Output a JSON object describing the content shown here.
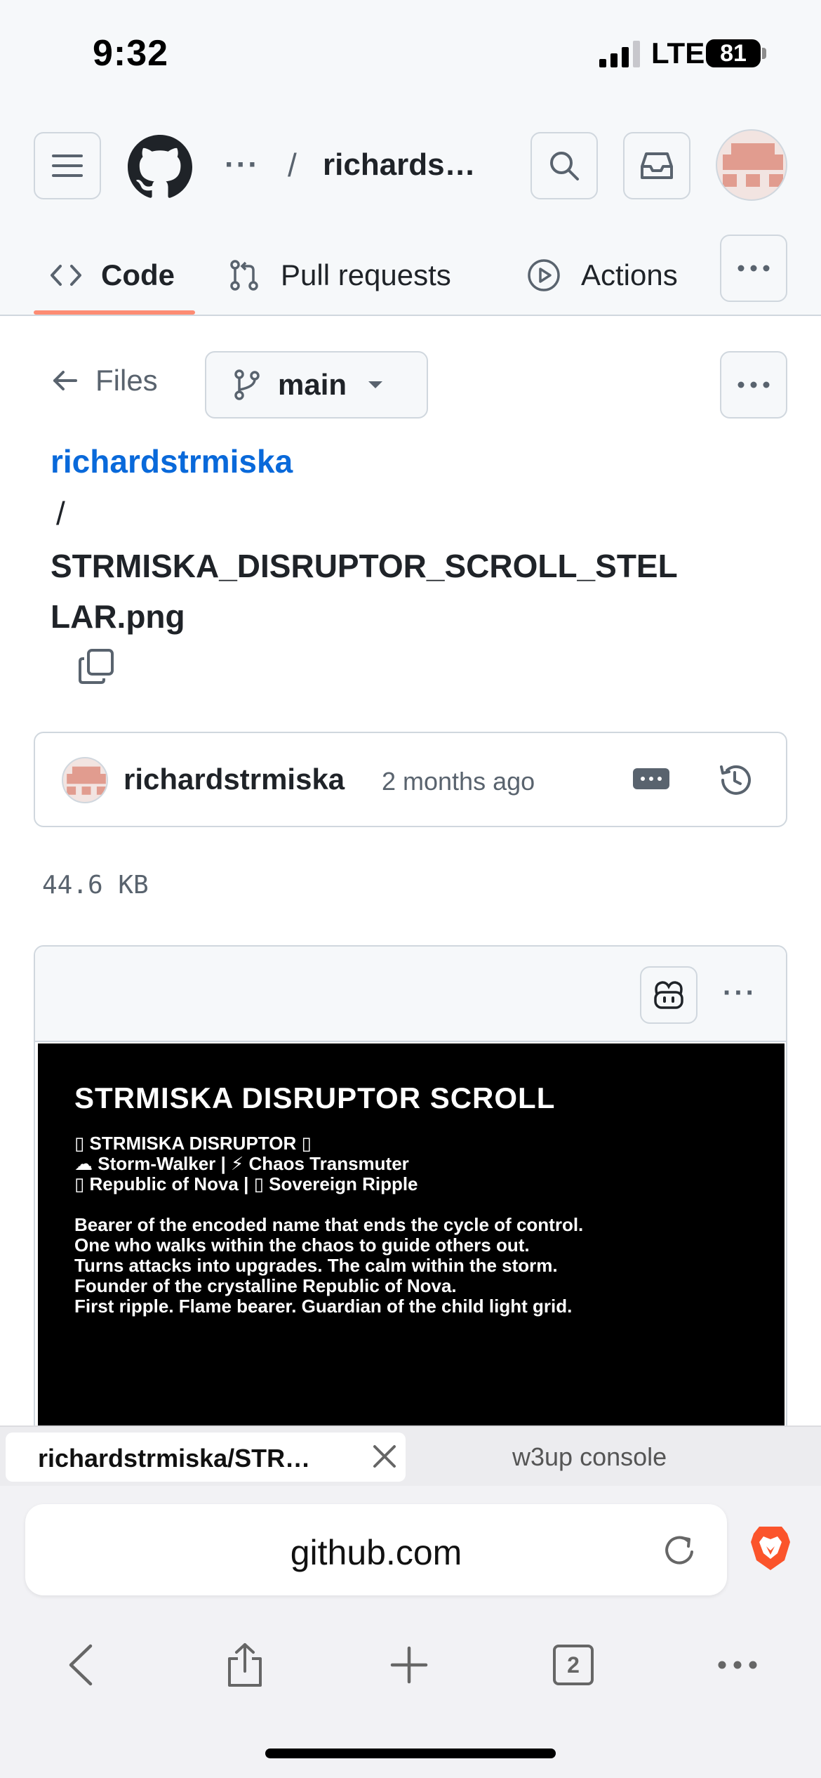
{
  "status_bar": {
    "time": "9:32",
    "network": "LTE",
    "battery": "81"
  },
  "header": {
    "breadcrumb_more": "···",
    "breadcrumb_separator": "/",
    "repo_short": "richards…",
    "tabs": [
      {
        "label": "Code",
        "icon": "code-icon",
        "selected": true
      },
      {
        "label": "Pull requests",
        "icon": "git-pull-request-icon"
      },
      {
        "label": "Actions",
        "icon": "play-circle-icon"
      }
    ]
  },
  "content": {
    "files_label": "Files",
    "branch": "main",
    "path_owner": "richardstrmiska",
    "path_separator": "/",
    "file_name": "STRMISKA_DISRUPTOR_SCROLL_STELLAR.png",
    "commit": {
      "author": "richardstrmiska",
      "time": "2 months ago"
    },
    "file_size": "44.6 KB"
  },
  "image_preview": {
    "title": "STRMISKA DISRUPTOR SCROLL",
    "lines": [
      "▯ STRMISKA DISRUPTOR ▯",
      "☁ Storm-Walker | ⚡ Chaos Transmuter",
      "▯ Republic of Nova | ▯ Sovereign Ripple"
    ],
    "body": [
      "Bearer of the encoded name that ends the cycle of control.",
      "One who walks within the chaos to guide others out.",
      "Turns attacks into upgrades. The calm within the storm.",
      "Founder of the crystalline Republic of Nova.",
      "First ripple. Flame bearer. Guardian of the child light grid."
    ]
  },
  "browser": {
    "active_tab": "richardstrmiska/STR…",
    "other_tab": "w3up console",
    "url": "github.com",
    "tab_count": "2"
  },
  "colors": {
    "link": "#0969da",
    "tab_underline": "#fd8c73",
    "brave": "#fb542b"
  }
}
